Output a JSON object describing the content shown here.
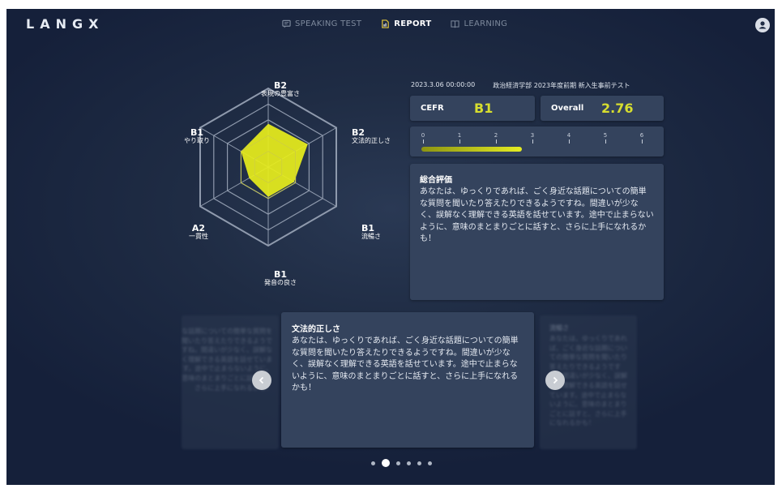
{
  "app": {
    "logo": "LANGX"
  },
  "nav": [
    {
      "label": "SPEAKING TEST",
      "icon": "chat-icon",
      "active": false
    },
    {
      "label": "REPORT",
      "icon": "report-icon",
      "active": true
    },
    {
      "label": "LEARNING",
      "icon": "book-icon",
      "active": false
    }
  ],
  "radar": {
    "axes": [
      {
        "level": "B2",
        "name": "表現の豊富さ"
      },
      {
        "level": "B2",
        "name": "文法的正しさ"
      },
      {
        "level": "B1",
        "name": "流暢さ"
      },
      {
        "level": "B1",
        "name": "発音の良さ"
      },
      {
        "level": "A2",
        "name": "一貫性"
      },
      {
        "level": "B1",
        "name": "やり取り"
      }
    ],
    "scores": [
      0.55,
      0.58,
      0.38,
      0.38,
      0.28,
      0.4
    ],
    "fill_color": "#e8ee1c"
  },
  "meta": {
    "datetime": "2023.3.06 00:00:00",
    "test_name": "政治経済学部 2023年度前期 新入生事前テスト"
  },
  "cefr": {
    "label": "CEFR",
    "value": "B1"
  },
  "overall": {
    "label": "Overall",
    "value": "2.76",
    "fraction_of_max": 0.46
  },
  "scale": {
    "ticks": [
      "0",
      "1",
      "2",
      "3",
      "4",
      "5",
      "6"
    ]
  },
  "summary": {
    "title": "総合評価",
    "body": "あなたは、ゆっくりであれば、ごく身近な話題についての簡単な質問を聞いたり答えたりできるようですね。間違いが少なく、誤解なく理解できる英語を話せています。途中で止まらないように、意味のまとまりごとに話すと、さらに上手になれるかも！"
  },
  "carousel": {
    "center": {
      "title": "文法的正しさ",
      "body": "あなたは、ゆっくりであれば、ごく身近な話題についての簡単な質問を聞いたり答えたりできるようですね。間違いが少なく、誤解なく理解できる英語を話せています。途中で止まらないように、意味のまとまりごとに話すと、さらに上手になれるかも！"
    },
    "left": {
      "body": "な話題についての簡単な質問を聞いたり答えたりできるようですね。間違いが少なく、誤解なく理解できる英語を話せています。途中で止まらないように、意味のまとまりごとに話すと、さらに上手になれるかも！"
    },
    "right": {
      "title": "流暢さ",
      "body": "あなたは、ゆっくりであれば、ごく身近な話題についての簡単な質問を聞いたり答えたりできるようですね。間違いが少なく、誤解なく理解できる英語を話せています。途中で止まらないように、意味のまとまりごとに話すと、さらに上手になれるかも！"
    },
    "dot_count": 6,
    "active_index": 1
  }
}
